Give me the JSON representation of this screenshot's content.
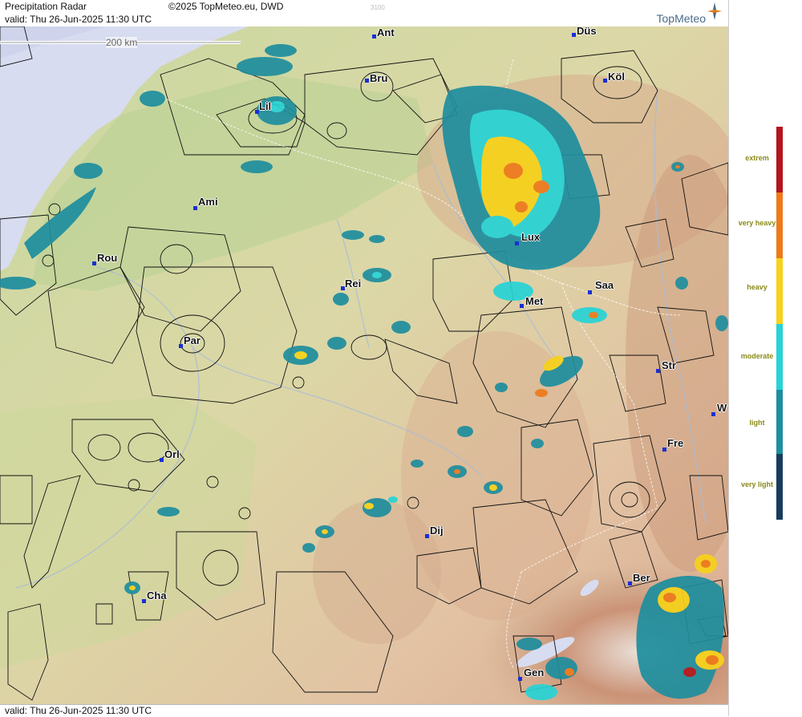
{
  "header": {
    "title": "Precipitation Radar",
    "copyright": "©2025 TopMeteo.eu, DWD",
    "valid": "valid:  Thu  26-Jun-2025 11:30 UTC",
    "code": "3100",
    "brand": "TopMeteo"
  },
  "footer": {
    "valid": "valid:  Thu  26-Jun-2025 11:30 UTC"
  },
  "scale": {
    "label": "200 km"
  },
  "legend": {
    "levels": [
      {
        "label": "extrem",
        "color": "#b3151b"
      },
      {
        "label": "very heavy",
        "color": "#ee7a1a"
      },
      {
        "label": "heavy",
        "color": "#f7d21a"
      },
      {
        "label": "moderate",
        "color": "#27d3d6"
      },
      {
        "label": "light",
        "color": "#1e8e9e"
      },
      {
        "label": "very light",
        "color": "#173d5c"
      }
    ]
  },
  "cities": [
    {
      "id": "ant",
      "label": "Ant"
    },
    {
      "id": "dus",
      "label": "Düs"
    },
    {
      "id": "bru",
      "label": "Bru"
    },
    {
      "id": "kol",
      "label": "Köl"
    },
    {
      "id": "lil",
      "label": "Lil"
    },
    {
      "id": "ami",
      "label": "Ami"
    },
    {
      "id": "lux",
      "label": "Lux"
    },
    {
      "id": "rou",
      "label": "Rou"
    },
    {
      "id": "rei",
      "label": "Rei"
    },
    {
      "id": "saa",
      "label": "Saa"
    },
    {
      "id": "met",
      "label": "Met"
    },
    {
      "id": "par",
      "label": "Par"
    },
    {
      "id": "str",
      "label": "Str"
    },
    {
      "id": "w",
      "label": "W"
    },
    {
      "id": "fre",
      "label": "Fre"
    },
    {
      "id": "orl",
      "label": "Orl"
    },
    {
      "id": "dij",
      "label": "Dij"
    },
    {
      "id": "ber",
      "label": "Ber"
    },
    {
      "id": "cha",
      "label": "Cha"
    },
    {
      "id": "gen",
      "label": "Gen"
    }
  ]
}
